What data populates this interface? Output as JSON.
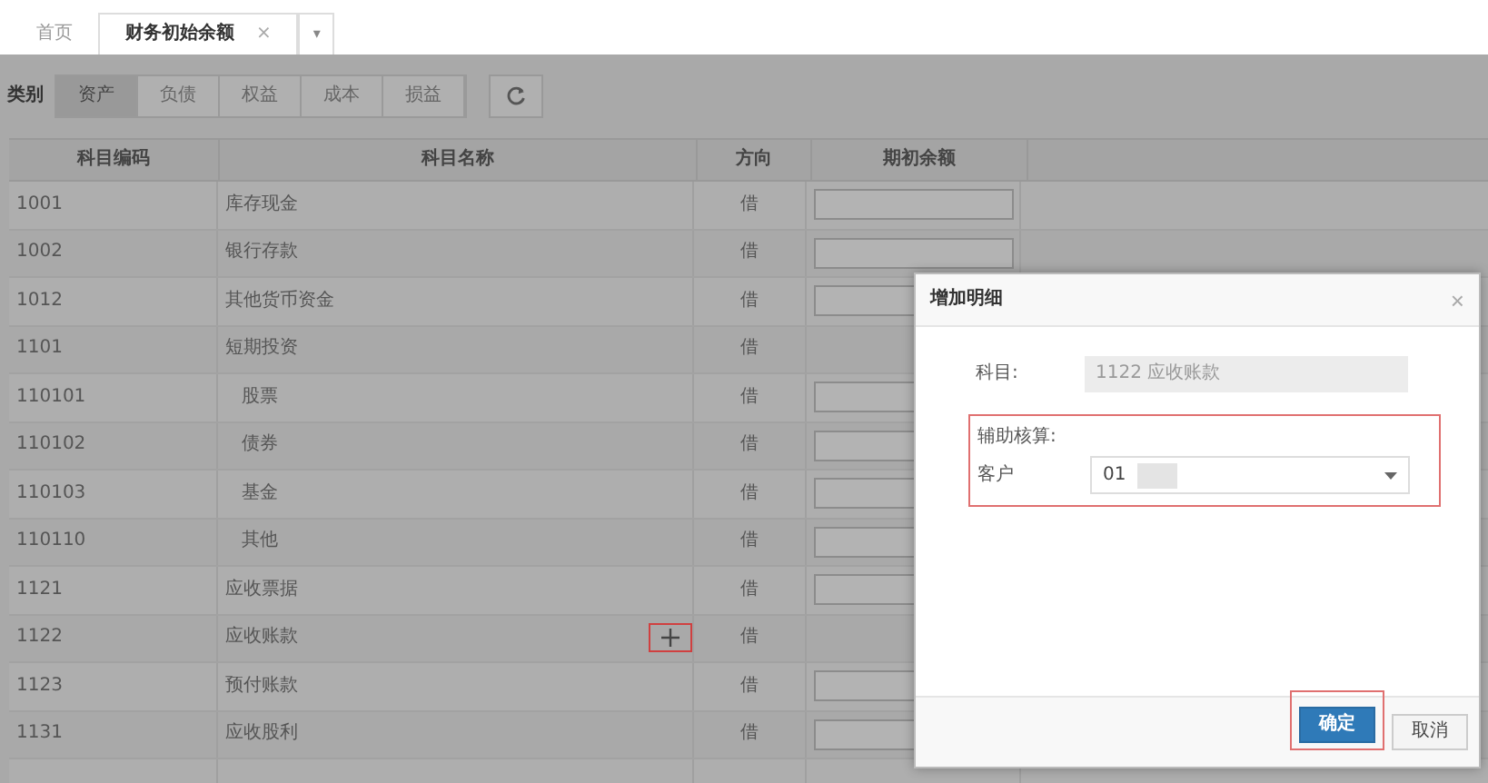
{
  "tabs": [
    {
      "label": "首页",
      "selected": false
    },
    {
      "label": "财务初始余额",
      "selected": true,
      "close": "×"
    }
  ],
  "tab_menu": "▾",
  "toolbar": {
    "label": "类别",
    "categories": [
      {
        "label": "资产",
        "selected": true
      },
      {
        "label": "负债",
        "selected": false
      },
      {
        "label": "权益",
        "selected": false
      },
      {
        "label": "成本",
        "selected": false
      },
      {
        "label": "损益",
        "selected": false
      }
    ]
  },
  "table": {
    "columns": [
      "科目编码",
      "科目名称",
      "方向",
      "期初余额"
    ],
    "rows": [
      {
        "code": "1001",
        "name": "库存现金",
        "direction": "借",
        "balance_input": true,
        "add_detail": false
      },
      {
        "code": "1002",
        "name": "银行存款",
        "direction": "借",
        "balance_input": true,
        "add_detail": false
      },
      {
        "code": "1012",
        "name": "其他货币资金",
        "direction": "借",
        "balance_input": true,
        "add_detail": false
      },
      {
        "code": "1101",
        "name": "短期投资",
        "direction": "借",
        "balance_input": false,
        "add_detail": false,
        "children": [
          {
            "code": "110101",
            "name": "股票",
            "direction": "借",
            "balance_input": true,
            "add_detail": false
          },
          {
            "code": "110102",
            "name": "债券",
            "direction": "借",
            "balance_input": true,
            "add_detail": false
          },
          {
            "code": "110103",
            "name": "基金",
            "direction": "借",
            "balance_input": true,
            "add_detail": false
          },
          {
            "code": "110110",
            "name": "其他",
            "direction": "借",
            "balance_input": true,
            "add_detail": false
          }
        ]
      },
      {
        "code": "1121",
        "name": "应收票据",
        "direction": "借",
        "balance_input": true,
        "add_detail": false
      },
      {
        "code": "1122",
        "name": "应收账款",
        "direction": "借",
        "balance_input": false,
        "add_detail": true
      },
      {
        "code": "1123",
        "name": "预付账款",
        "direction": "借",
        "balance_input": true,
        "add_detail": false
      },
      {
        "code": "1131",
        "name": "应收股利",
        "direction": "借",
        "balance_input": true,
        "add_detail": false
      }
    ]
  },
  "dialog": {
    "title": "增加明细",
    "close": "×",
    "subject": {
      "label": "科目:",
      "value": "1122 应收账款"
    },
    "auxiliary": {
      "label": "辅助核算:",
      "field_label": "客户",
      "value": "01"
    },
    "buttons": [
      {
        "label": "确定",
        "kind": "primary"
      },
      {
        "label": "取消",
        "kind": "default"
      }
    ]
  }
}
